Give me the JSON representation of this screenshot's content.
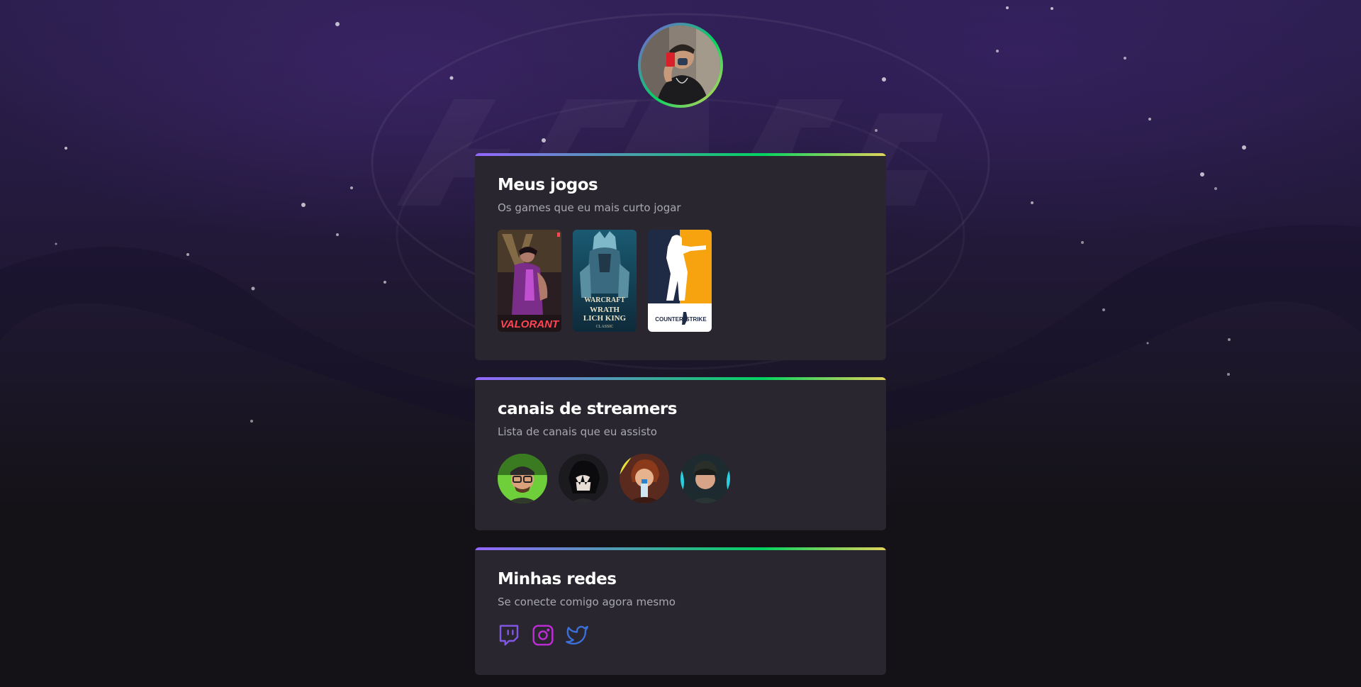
{
  "profile": {
    "avatar_alt": "Foto de perfil"
  },
  "games_card": {
    "title": "Meus jogos",
    "subtitle": "Os games que eu mais curto jogar",
    "games": [
      {
        "name": "VALORANT",
        "icon": "valorant-cover"
      },
      {
        "name": "WRATH LICH KING",
        "icon": "wow-cover"
      },
      {
        "name": "COUNTER STRIKE",
        "icon": "counter-strike-cover"
      }
    ]
  },
  "streamers_card": {
    "title": "canais de streamers",
    "subtitle": "Lista de canais que eu assisto",
    "streamers": [
      {
        "icon": "streamer-avatar"
      },
      {
        "icon": "streamer-avatar"
      },
      {
        "icon": "streamer-avatar"
      },
      {
        "icon": "streamer-avatar"
      }
    ]
  },
  "socials_card": {
    "title": "Minhas redes",
    "subtitle": "Se conecte comigo agora mesmo",
    "links": [
      {
        "icon": "twitch-icon",
        "color": "#8257e5"
      },
      {
        "icon": "instagram-icon",
        "color": "#c02cd8"
      },
      {
        "icon": "twitter-icon",
        "color": "#3b6fd9"
      }
    ]
  },
  "colors": {
    "card_bg": "#29262f",
    "accent_gradient": [
      "#9466ff",
      "#04d361",
      "#e1d35a"
    ],
    "title": "#ffffff",
    "subtitle": "#a8a8b3"
  }
}
